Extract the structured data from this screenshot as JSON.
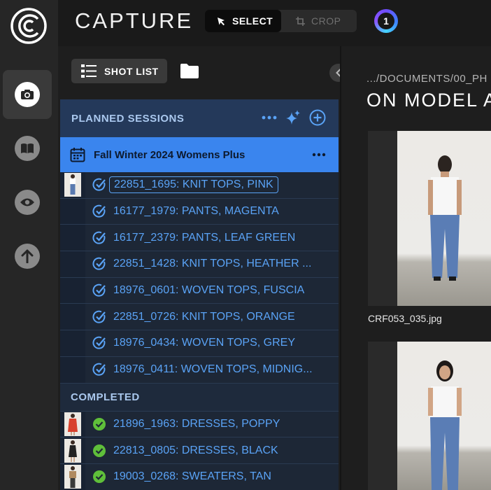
{
  "app": {
    "title": "CAPTURE"
  },
  "toolbar": {
    "select_label": "SELECT",
    "crop_label": "CROP",
    "account_badge": "1"
  },
  "rail": {
    "items": [
      "camera-icon",
      "book-icon",
      "eye-icon",
      "upload-icon"
    ]
  },
  "shot_list": {
    "button_label": "SHOT LIST"
  },
  "panel": {
    "planned_title": "PLANNED SESSIONS",
    "session_title": "Fall Winter 2024 Womens Plus",
    "planned_items": [
      "22851_1695: KNIT TOPS, PINK",
      "16177_1979: PANTS, MAGENTA",
      "16177_2379: PANTS, LEAF GREEN",
      "22851_1428: KNIT TOPS, HEATHER ...",
      "18976_0601: WOVEN TOPS, FUSCIA",
      "22851_0726: KNIT TOPS, ORANGE",
      "18976_0434: WOVEN TOPS, GREY",
      "18976_0411: WOVEN TOPS, MIDNIG..."
    ],
    "completed_title": "COMPLETED",
    "completed_items": [
      "21896_1963: DRESSES, POPPY",
      "22813_0805: DRESSES, BLACK",
      "19003_0268: SWEATERS, TAN"
    ]
  },
  "main": {
    "breadcrumb": ".../DOCUMENTS/00_PH",
    "title": "ON MODEL A",
    "photos": [
      {
        "caption": "CRF053_035.jpg"
      }
    ]
  },
  "colors": {
    "accent": "#3a85ee",
    "panel_header": "#24395a",
    "link": "#5aa3f6",
    "success": "#5fbf3a"
  }
}
